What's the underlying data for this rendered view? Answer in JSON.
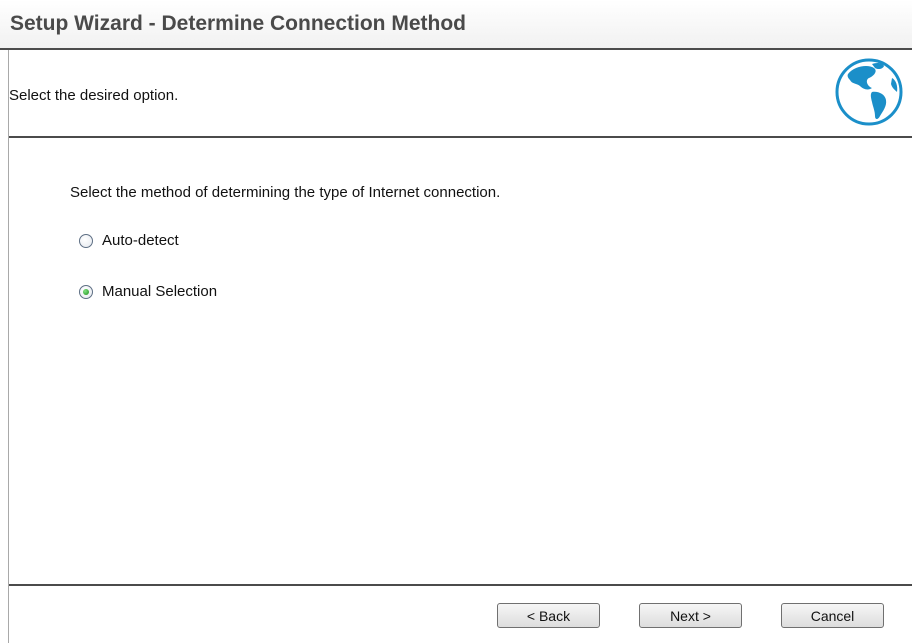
{
  "wizard": {
    "title": "Setup Wizard - Determine Connection Method",
    "instruction": "Select the desired option.",
    "globe_icon": "globe-icon",
    "accent_color": "#1b8fc9"
  },
  "content": {
    "prompt": "Select the method of determining the type of Internet connection.",
    "options": [
      {
        "label": "Auto-detect",
        "selected": false
      },
      {
        "label": "Manual Selection",
        "selected": true
      }
    ]
  },
  "footer": {
    "back_label": "< Back",
    "next_label": "Next >",
    "cancel_label": "Cancel"
  }
}
